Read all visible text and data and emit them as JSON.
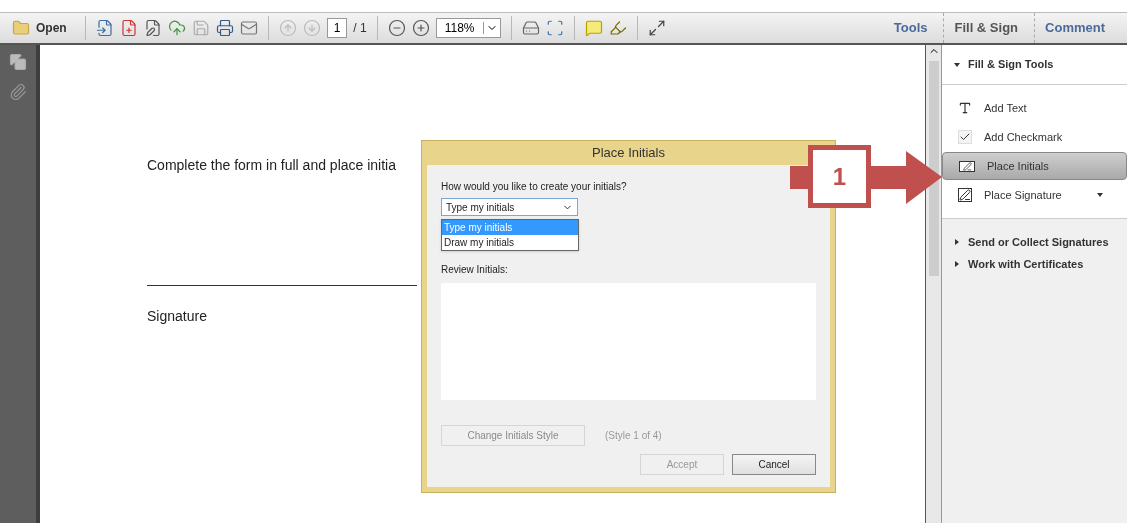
{
  "toolbar": {
    "open_label": "Open",
    "page": "1",
    "page_total": "/ 1",
    "zoom": "118%"
  },
  "tabs": [
    {
      "label": "Tools",
      "selected": false
    },
    {
      "label": "Fill & Sign",
      "selected": true
    },
    {
      "label": "Comment",
      "selected": false
    }
  ],
  "document": {
    "lines": [
      {
        "kind": "text",
        "text": "Complete the form in full and place initia"
      },
      {
        "kind": "rule"
      },
      {
        "kind": "text",
        "text": "Signature"
      }
    ]
  },
  "panel": {
    "header": "Fill & Sign Tools",
    "expanded": true,
    "items": [
      {
        "kind": "text",
        "label": "Add Text",
        "selected": false
      },
      {
        "kind": "check",
        "label": "Add Checkmark",
        "selected": false
      },
      {
        "kind": "initials",
        "label": "Place Initials",
        "selected": true
      },
      {
        "kind": "signature",
        "label": "Place Signature",
        "selected": false
      }
    ],
    "sections": [
      {
        "label": "Send or Collect Signatures",
        "expanded": false
      },
      {
        "label": "Work with Certificates",
        "expanded": false
      }
    ]
  },
  "dialog": {
    "title": "Place Initials",
    "question": "How would you like to create your initials?",
    "value": "Type my initials",
    "options": [
      {
        "label": "Type my initials",
        "selected": true
      },
      {
        "label": "Draw my initials",
        "selected": false
      }
    ],
    "review_label": "Review Initials:",
    "change_style": {
      "label": "Change Initials Style",
      "disabled": true
    },
    "style_note": "(Style 1 of 4)",
    "accept": {
      "label": "Accept",
      "disabled": true
    },
    "cancel": {
      "label": "Cancel",
      "disabled": false
    }
  },
  "callout": {
    "number": "1"
  }
}
